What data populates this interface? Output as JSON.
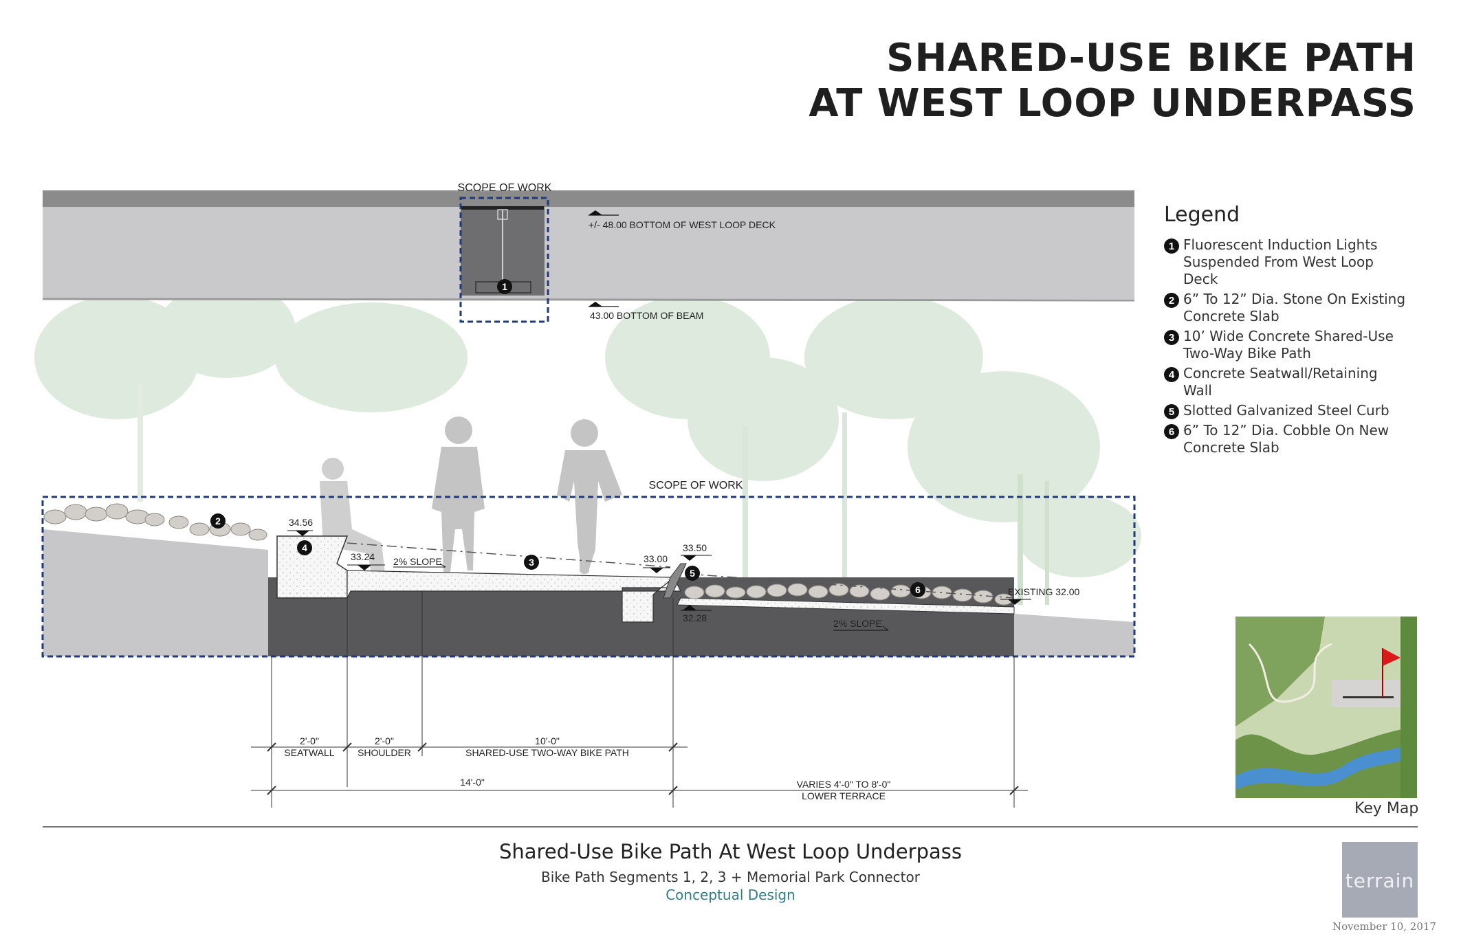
{
  "title": {
    "line1": "SHARED-USE BIKE PATH",
    "line2": "AT WEST LOOP UNDERPASS"
  },
  "annotations": {
    "scope_top": "SCOPE OF WORK",
    "scope_bottom": "SCOPE OF WORK",
    "deck_elev": "+/- 48.00 BOTTOM OF WEST LOOP DECK",
    "beam_elev": "43.00 BOTTOM OF BEAM",
    "spot_3456": "34.56",
    "spot_3324": "33.24",
    "spot_3300": "33.00",
    "spot_3350": "33.50",
    "spot_3228": "32.28",
    "spot_existing": "EXISTING 32.00",
    "slope_path": "2% SLOPE",
    "slope_terrace": "2% SLOPE"
  },
  "callouts": {
    "c1": "1",
    "c2": "2",
    "c3": "3",
    "c4": "4",
    "c5": "5",
    "c6": "6"
  },
  "dimensions": {
    "seatwall_dim": "2'-0\"",
    "seatwall_label": "SEATWALL",
    "shoulder_dim": "2'-0\"",
    "shoulder_label": "SHOULDER",
    "path_dim": "10'-0\"",
    "path_label": "SHARED-USE TWO-WAY BIKE PATH",
    "total_dim": "14'-0\"",
    "terrace_dim": "VARIES 4'-0\" TO 8'-0\"",
    "terrace_label": "LOWER TERRACE"
  },
  "legend": {
    "title": "Legend",
    "items": [
      {
        "num": "1",
        "text": "Fluorescent Induction Lights Suspended From West Loop Deck"
      },
      {
        "num": "2",
        "text": "6” To 12” Dia. Stone On Existing Concrete Slab"
      },
      {
        "num": "3",
        "text": "10’ Wide Concrete Shared-Use Two-Way Bike Path"
      },
      {
        "num": "4",
        "text": "Concrete Seatwall/Retaining Wall"
      },
      {
        "num": "5",
        "text": "Slotted Galvanized Steel Curb"
      },
      {
        "num": "6",
        "text": "6” To 12” Dia. Cobble On New Concrete Slab"
      }
    ]
  },
  "keymap_label": "Key Map",
  "footer": {
    "title": "Shared-Use Bike Path At West Loop Underpass",
    "subtitle": "Bike Path Segments 1, 2, 3 + Memorial Park Connector",
    "status": "Conceptual Design"
  },
  "logo_text": "terrain",
  "date": "November 10, 2017",
  "colors": {
    "scope_dash": "#1f3a7a",
    "deck": "#c9c8ca",
    "deck_top": "#8b8b8b",
    "dark_ground": "#58585a",
    "trees": "#dce8dc",
    "teal_text": "#2f7d86"
  }
}
